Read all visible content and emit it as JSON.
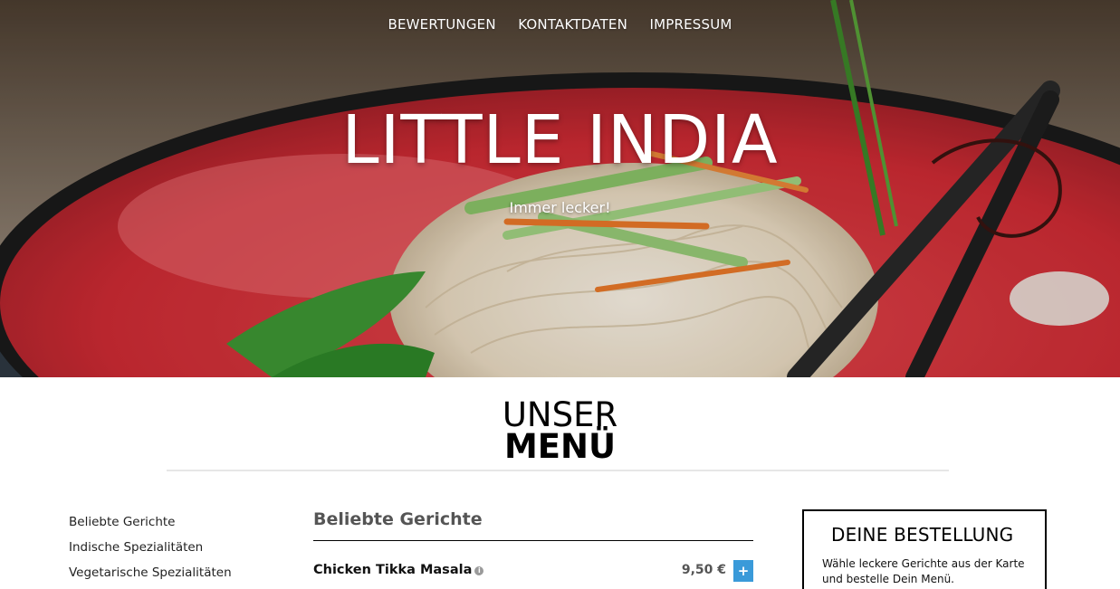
{
  "nav": {
    "items": [
      {
        "label": "BEWERTUNGEN"
      },
      {
        "label": "KONTAKTDATEN"
      },
      {
        "label": "IMPRESSUM"
      }
    ]
  },
  "hero": {
    "title": "LITTLE INDIA",
    "subtitle": "Immer lecker!"
  },
  "menu_heading": {
    "line1": "UNSER",
    "line2": "MENÜ"
  },
  "categories": [
    {
      "label": "Beliebte Gerichte"
    },
    {
      "label": "Indische Spezialitäten"
    },
    {
      "label": "Vegetarische Spezialitäten"
    }
  ],
  "dishes": {
    "section_title": "Beliebte Gerichte",
    "items": [
      {
        "name": "Chicken Tikka Masala",
        "info_icon": "info-icon",
        "price": "9,50 €",
        "add_label": "+"
      }
    ]
  },
  "order": {
    "title": "DEINE BESTELLUNG",
    "text": "Wähle leckere Gerichte aus der Karte und bestelle Dein Menü."
  },
  "colors": {
    "accent": "#3a9ad9",
    "plate_red": "#d8323a",
    "text_dark": "#111111",
    "text_gray": "#555555"
  }
}
